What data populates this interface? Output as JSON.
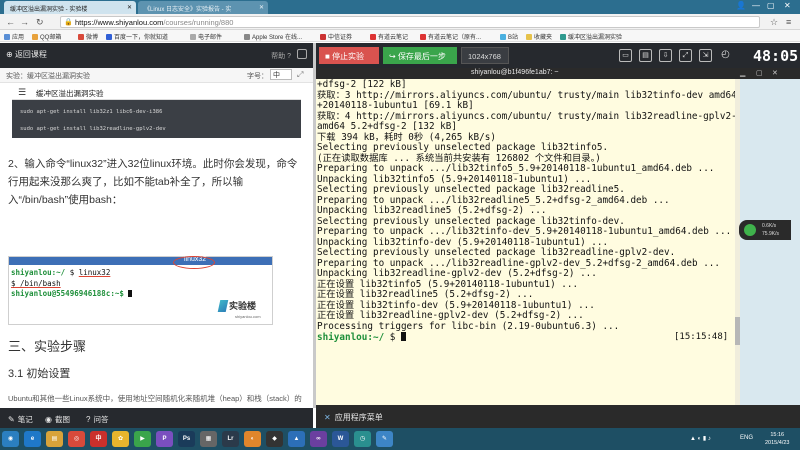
{
  "browser": {
    "tabs": [
      {
        "label": "缓冲区溢出漏洞实验 - 实验楼",
        "active": true
      },
      {
        "label": "《Linux 日志安全》实验报告 - 实",
        "active": false
      }
    ],
    "window_controls": {
      "user": "👤",
      "minimize": "—",
      "maximize": "▢",
      "close": "✕"
    },
    "url_host": "https://www.shiyanlou.com",
    "url_path": "/courses/running/880",
    "bookmarks": [
      "应用",
      "QQ邮箱",
      "微博",
      "百度一下，你就知道",
      "电子邮件",
      "Apple Store 在线...",
      "中信证券",
      "有道云笔记",
      "有道云笔记（原有...",
      "B站",
      "收藏夹",
      "缓冲区溢出漏洞实验"
    ]
  },
  "left_panel": {
    "back_label": "返回课程",
    "help_label": "帮助 ?",
    "experiment_label": "实验：缓冲区溢出漏洞实验",
    "font_label": "字号：",
    "font_value": "中",
    "section_title": "缓冲区溢出漏洞实验",
    "code_lines": [
      "sudo apt-get install lib32z1 libc6-dev-i386",
      "sudo apt-get install lib32readline-gplv2-dev"
    ],
    "step_text": "2、输入命令“linux32”进入32位linux环境。此时你会发现，命令行用起来没那么爽了，比如不能tab补全了，所以输入“/bin/bash”使用bash：",
    "screenshot": {
      "bar_title": "linux32",
      "line1_prompt": "shiyanlou:~/",
      "line1_cmd": "linux32",
      "line2": "$ /bin/bash",
      "line3_prompt": "shiyanlou@55496946188c:~$",
      "logo": "实验楼",
      "logo_sub": "shiyanlou.com"
    },
    "heading3": "三、实验步骤",
    "heading31": "3.1 初始设置",
    "paragraph": "Ubuntu和其他一些Linux系统中，使用地址空间随机化来随机堆（heap）和栈（stack）的初始地址，这使得猜测准确的内存地址变得十分困难，而猜测内存地址是缓冲区溢出攻击的关键。因此本次实验中，我们使用以下命令关闭这一功能：",
    "bottom_items": [
      {
        "icon": "✎",
        "label": "笔记"
      },
      {
        "icon": "◉",
        "label": "截图"
      },
      {
        "icon": "?",
        "label": "问答"
      }
    ]
  },
  "right_panel": {
    "stop_label": "停止实验",
    "save_label": "保存最后一步",
    "resolution": "1024x768",
    "timer": "48:05",
    "terminal_title": "shiyanlou@b1f496fe1ab7: ~",
    "terminal_lines": [
      "+dfsg-2 [122 kB]",
      "获取：3 http://mirrors.aliyuncs.com/ubuntu/ trusty/main lib32tinfo-dev amd64 5.9",
      "+20140118-1ubuntu1 [69.1 kB]",
      "获取：4 http://mirrors.aliyuncs.com/ubuntu/ trusty/main lib32readline-gplv2-dev",
      "amd64 5.2+dfsg-2 [132 kB]",
      "下载 394 kB，耗时 0秒 (4,265 kB/s)",
      "Selecting previously unselected package lib32tinfo5.",
      "(正在读取数据库 ... 系统当前共安装有 126802 个文件和目录。)",
      "Preparing to unpack .../lib32tinfo5_5.9+20140118-1ubuntu1_amd64.deb ...",
      "Unpacking lib32tinfo5 (5.9+20140118-1ubuntu1) ...",
      "Selecting previously unselected package lib32readline5.",
      "Preparing to unpack .../lib32readline5_5.2+dfsg-2_amd64.deb ...",
      "Unpacking lib32readline5 (5.2+dfsg-2) ...",
      "Selecting previously unselected package lib32tinfo-dev.",
      "Preparing to unpack .../lib32tinfo-dev_5.9+20140118-1ubuntu1_amd64.deb ...",
      "Unpacking lib32tinfo-dev (5.9+20140118-1ubuntu1) ...",
      "Selecting previously unselected package lib32readline-gplv2-dev.",
      "Preparing to unpack .../lib32readline-gplv2-dev_5.2+dfsg-2_amd64.deb ...",
      "Unpacking lib32readline-gplv2-dev (5.2+dfsg-2) ...",
      "正在设置 lib32tinfo5 (5.9+20140118-1ubuntu1) ...",
      "正在设置 lib32readline5 (5.2+dfsg-2) ...",
      "正在设置 lib32tinfo-dev (5.9+20140118-1ubuntu1) ...",
      "正在设置 lib32readline-gplv2-dev (5.2+dfsg-2) ...",
      "Processing triggers for libc-bin (2.19-0ubuntu6.3) ..."
    ],
    "terminal_prompt": "shiyanlou:~/",
    "terminal_prompt_symbol": "$",
    "terminal_timestamp": "[15:15:48]",
    "net_up": "0.6K/s",
    "net_down": "75.9K/s",
    "app_menu": "应用程序菜单"
  },
  "taskbar": {
    "apps": [
      {
        "icon": "start-orb",
        "color": "#2b7fc0",
        "glyph": "◉"
      },
      {
        "icon": "ie",
        "color": "#1f78c8",
        "glyph": "e"
      },
      {
        "icon": "explorer",
        "color": "#d8a33a",
        "glyph": "▤"
      },
      {
        "icon": "chrome",
        "color": "#d84a3b",
        "glyph": "◎"
      },
      {
        "icon": "app-red",
        "color": "#c9302c",
        "glyph": "中"
      },
      {
        "icon": "app-yellow",
        "color": "#e7b52d",
        "glyph": "✿"
      },
      {
        "icon": "app-green",
        "color": "#3aa54b",
        "glyph": "▶"
      },
      {
        "icon": "app-purple",
        "color": "#7a4fbf",
        "glyph": "P"
      },
      {
        "icon": "photoshop",
        "color": "#1a3b5a",
        "glyph": "Ps"
      },
      {
        "icon": "app-gray",
        "color": "#666",
        "glyph": "▦"
      },
      {
        "icon": "lightroom",
        "color": "#2b3a4a",
        "glyph": "Lr"
      },
      {
        "icon": "app-orange",
        "color": "#e0862c",
        "glyph": "◐"
      },
      {
        "icon": "app-dark",
        "color": "#333",
        "glyph": "◆"
      },
      {
        "icon": "app-blue",
        "color": "#2c6fb8",
        "glyph": "▲"
      },
      {
        "icon": "visual-studio",
        "color": "#6b3fa0",
        "glyph": "∞"
      },
      {
        "icon": "word",
        "color": "#2b5797",
        "glyph": "W"
      },
      {
        "icon": "app-teal",
        "color": "#2a8f8f",
        "glyph": "◷"
      },
      {
        "icon": "app-blue2",
        "color": "#3d85c6",
        "glyph": "✎"
      }
    ],
    "lang": "ENG",
    "time": "15:16",
    "date": "2015/4/23"
  }
}
